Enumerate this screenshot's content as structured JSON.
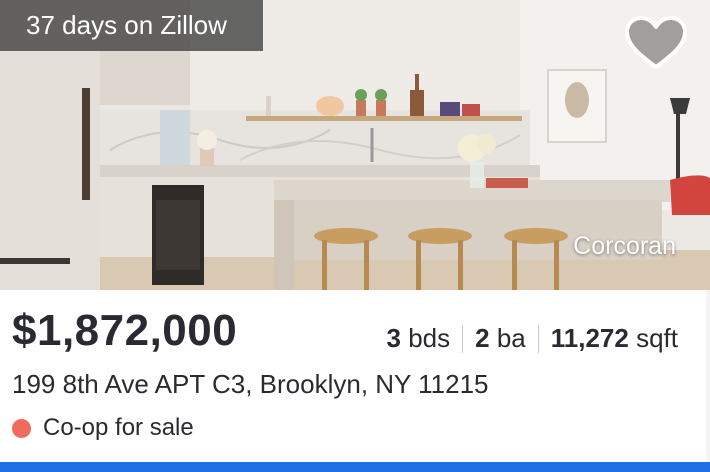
{
  "listing": {
    "days_on_zillow": "37 days on Zillow",
    "broker": "Corcoran",
    "price": "$1,872,000",
    "beds_value": "3",
    "beds_unit": "bds",
    "baths_value": "2",
    "baths_unit": "ba",
    "sqft_value": "11,272",
    "sqft_unit": "sqft",
    "address": "199 8th Ave APT C3, Brooklyn, NY 11215",
    "status": "Co-op for sale"
  },
  "icons": {
    "favorite": "heart-icon",
    "status": "status-dot-icon"
  },
  "colors": {
    "status_dot": "#f06b5d",
    "accent_bar": "#1f6fe5",
    "text": "#2a2a33"
  }
}
